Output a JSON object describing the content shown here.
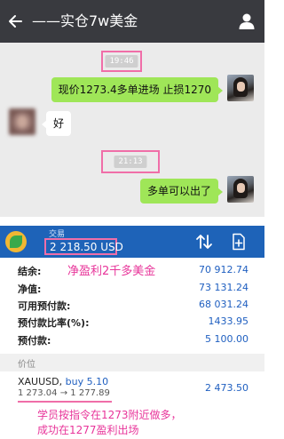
{
  "chat": {
    "title": "——实仓7w美金",
    "messages": [
      {
        "type": "time",
        "text": "19:46"
      },
      {
        "type": "out",
        "text": "现价1273.4多单进场 止损1270"
      },
      {
        "type": "in",
        "text": "好"
      },
      {
        "type": "time",
        "text": "21:13"
      },
      {
        "type": "out",
        "text": "多单可以出了"
      }
    ]
  },
  "trade": {
    "header_sub": "交易",
    "balance": "2 218.50 USD",
    "rows": [
      {
        "label": "结余:",
        "value": "70 912.74"
      },
      {
        "label": "净值:",
        "value": "73 131.24"
      },
      {
        "label": "可用预付款:",
        "value": "68 031.24"
      },
      {
        "label": "预付款比率(%):",
        "value": "1433.95"
      },
      {
        "label": "预付款:",
        "value": "5 100.00"
      }
    ],
    "section_label": "价位",
    "position": {
      "symbol": "XAUUSD,",
      "side": "buy 5.10",
      "open_price": "1 273.04",
      "arrow": "→",
      "current_price": "1 277.89",
      "profit": "2 473.50"
    }
  },
  "annotations": {
    "profit_note": "净盈利2千多美金",
    "caption_line1": "学员按指令在1273附近做多，",
    "caption_line2": "成功在1277盈利出场"
  },
  "colors": {
    "chat_header_bg": "#393a3f",
    "chat_bg": "#ebebeb",
    "outgoing_bubble": "#9fe658",
    "trade_header_bg": "#1e63b8",
    "value_blue": "#1f5fc0",
    "highlight_pink": "#f06ea8",
    "annotation_pink": "#e8359a"
  }
}
